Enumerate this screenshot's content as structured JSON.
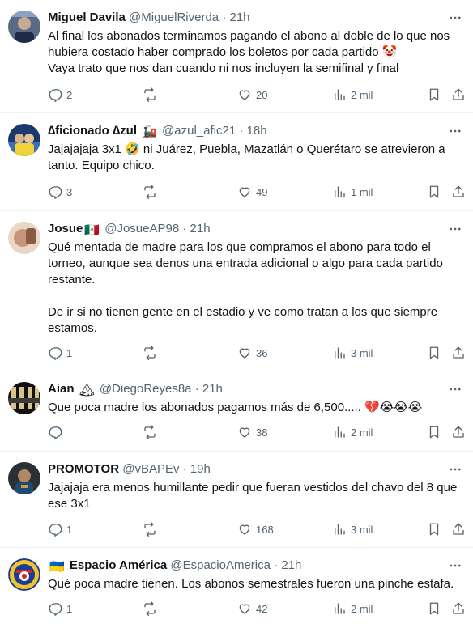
{
  "tweets": [
    {
      "name": "Miguel Davila",
      "handle": "@MiguelRiverda",
      "dot": "·",
      "time": "21h",
      "text": "Al final los abonados terminamos pagando el abono al doble de lo que nos hubiera costado haber comprado los boletos por cada partido 🤡\nVaya trato que nos dan cuando ni nos incluyen la semifinal y final",
      "replies": "2",
      "retweets": "",
      "likes": "20",
      "views": "2 mil"
    },
    {
      "name": "∆ficionado ∆zul",
      "name_emoji": "🚂",
      "handle": "@azul_afic21",
      "dot": "·",
      "time": "18h",
      "text": "Jajajajaja 3x1 🤣 ni Juárez, Puebla, Mazatlán o Querétaro se atrevieron a tanto. Equipo chico.",
      "replies": "3",
      "retweets": "",
      "likes": "49",
      "views": "1 mil"
    },
    {
      "name": "Josue",
      "name_emoji": "🇲🇽",
      "handle": "@JosueAP98",
      "dot": "·",
      "time": "21h",
      "text": "Qué mentada de madre para los que compramos el abono para todo el torneo, aunque sea denos una entrada adicional o algo para cada partido restante.\n\nDe ir si no tienen gente en el estadio y ve como tratan a los que siempre estamos.",
      "replies": "1",
      "retweets": "",
      "likes": "36",
      "views": "3 mil"
    },
    {
      "name": "Aian",
      "name_emoji": "🏔",
      "handle": "@DiegoReyes8a",
      "dot": "·",
      "time": "21h",
      "text": "Que poca madre los abonados pagamos más de 6,500..... 💔😭😭😭",
      "replies": "",
      "retweets": "",
      "likes": "38",
      "views": "2 mil"
    },
    {
      "name": "PROMOTOR",
      "handle": "@vBAPEv",
      "dot": "·",
      "time": "19h",
      "text": "Jajajaja era menos humillante pedir que fueran vestidos del chavo del 8 que ese 3x1",
      "replies": "1",
      "retweets": "",
      "likes": "168",
      "views": "3 mil"
    },
    {
      "name": "Espacio América",
      "name_emoji": "🇺🇦",
      "handle": "@EspacioAmerica",
      "dot": "·",
      "time": "21h",
      "text": "Qué poca madre tienen. Los abonos semestrales fueron una pinche estafa.",
      "replies": "1",
      "retweets": "",
      "likes": "42",
      "views": "2 mil"
    }
  ],
  "colors": {
    "text": "#0f1419",
    "muted": "#536471",
    "divider": "#eff3f4"
  },
  "icons": [
    "reply-icon",
    "retweet-icon",
    "like-icon",
    "views-icon",
    "bookmark-icon",
    "share-icon",
    "more-icon"
  ]
}
